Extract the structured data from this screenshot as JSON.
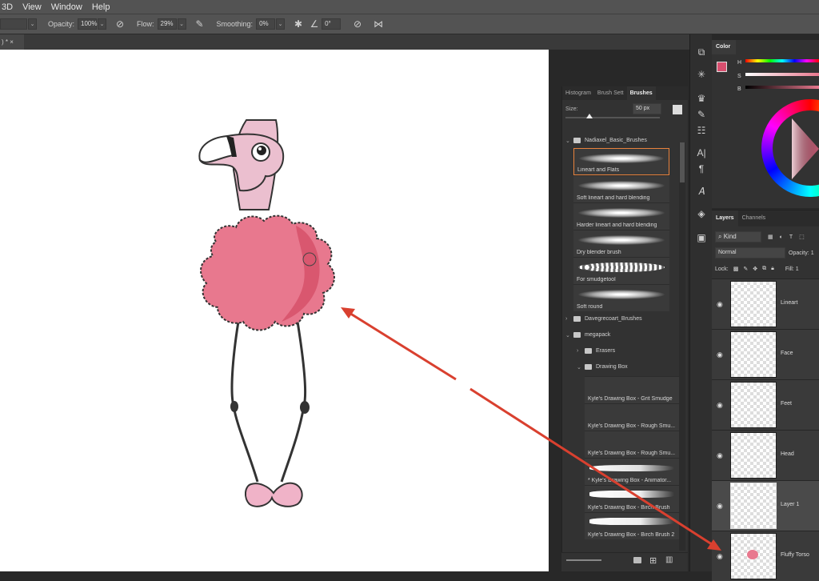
{
  "menubar": {
    "items": [
      "3D",
      "View",
      "Window",
      "Help"
    ]
  },
  "options": {
    "opacity_label": "Opacity:",
    "opacity_value": "100%",
    "flow_label": "Flow:",
    "flow_value": "29%",
    "smoothing_label": "Smoothing:",
    "smoothing_value": "0%",
    "angle_value": "0°"
  },
  "document_tab": {
    "close": "×"
  },
  "brushes_panel": {
    "tabs": [
      "Histogram",
      "Brush Sett",
      "Brushes"
    ],
    "size_label": "Size:",
    "size_value": "50 px",
    "folders": [
      {
        "name": "Nadiaxel_Basic_Brushes",
        "expanded": true
      },
      {
        "name": "Davegrecoart_Brushes",
        "expanded": false
      },
      {
        "name": "megapack",
        "expanded": true
      },
      {
        "name": "Erasers",
        "expanded": false
      },
      {
        "name": "Drawing Box",
        "expanded": true
      }
    ],
    "brushes_group1": [
      {
        "name": "Lineart and Flats",
        "selected": true
      },
      {
        "name": "Soft lineart and hard blending"
      },
      {
        "name": "Harder lineart and hard blending"
      },
      {
        "name": "Dry blender brush"
      },
      {
        "name": "For smudgetool"
      },
      {
        "name": "Soft round"
      }
    ],
    "brushes_group2": [
      {
        "name": "Kyle's Drawing Box - Grit Smudge"
      },
      {
        "name": "Kyle's Drawing Box - Rough Smu..."
      },
      {
        "name": "Kyle's Drawing Box - Rough Smu..."
      },
      {
        "name": "* Kyle's Drawing Box - Animator..."
      },
      {
        "name": "Kyle's Drawing Box - Birch Brush"
      },
      {
        "name": "Kyle's Drawing Box - Birch Brush 2"
      }
    ]
  },
  "color_panel": {
    "tab": "Color",
    "labels": [
      "H",
      "S",
      "B"
    ],
    "fg_color": "#d84f6f"
  },
  "layers_panel": {
    "tabs": [
      "Layers",
      "Channels"
    ],
    "kind_label": "Kind",
    "blend_mode": "Normal",
    "opacity_label": "Opacity:",
    "opacity_value": "1",
    "lock_label": "Lock:",
    "fill_label": "Fill:",
    "fill_value": "1",
    "layers": [
      {
        "name": "Lineart"
      },
      {
        "name": "Face"
      },
      {
        "name": "Feet"
      },
      {
        "name": "Head"
      },
      {
        "name": "Layer 1",
        "selected": true
      },
      {
        "name": "Fluffy Torso"
      }
    ]
  }
}
